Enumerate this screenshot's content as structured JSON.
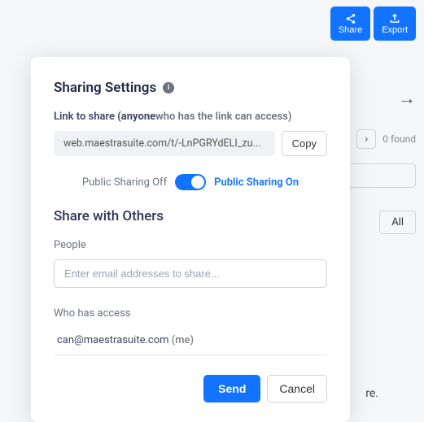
{
  "topbar": {
    "share": "Share",
    "export": "Export"
  },
  "background": {
    "found": "0 found",
    "all_btn": "All",
    "re_text": "re."
  },
  "modal": {
    "title": "Sharing Settings",
    "link_label_prefix": "Link to share ",
    "link_label_bold": "(anyone",
    "link_label_rest": "who has the link can access)",
    "share_url": "web.maestrasuite.com/t/-LnPGRYdELI_zu...",
    "copy": "Copy",
    "toggle_off": "Public Sharing Off",
    "toggle_on": "Public Sharing On",
    "share_others": "Share with Others",
    "people_label": "People",
    "people_placeholder": "Enter email addresses to share...",
    "access_label": "Who has access",
    "access_email": "can@maestrasuite.com",
    "access_me": "(me)",
    "send": "Send",
    "cancel": "Cancel"
  }
}
